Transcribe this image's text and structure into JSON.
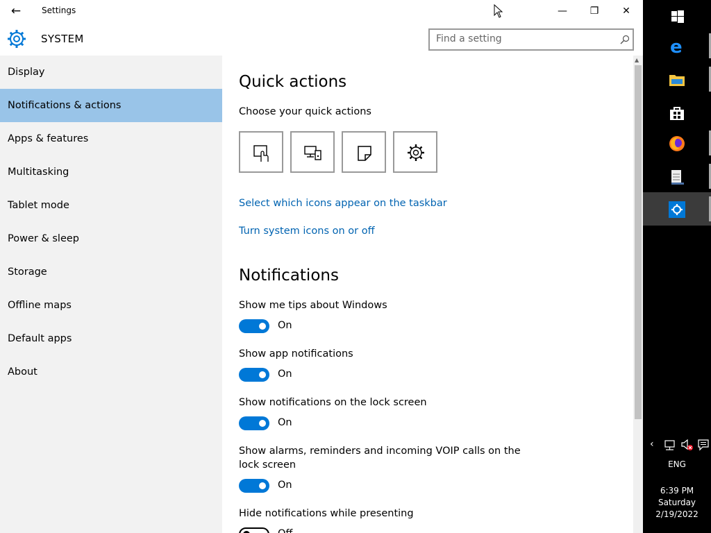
{
  "window": {
    "title": "Settings",
    "back_icon": "←",
    "minimize_icon": "—",
    "maximize_icon": "❐",
    "close_icon": "✕"
  },
  "header": {
    "section": "SYSTEM",
    "search_placeholder": "Find a setting"
  },
  "sidebar": {
    "items": [
      {
        "label": "Display"
      },
      {
        "label": "Notifications & actions",
        "selected": true
      },
      {
        "label": "Apps & features"
      },
      {
        "label": "Multitasking"
      },
      {
        "label": "Tablet mode"
      },
      {
        "label": "Power & sleep"
      },
      {
        "label": "Storage"
      },
      {
        "label": "Offline maps"
      },
      {
        "label": "Default apps"
      },
      {
        "label": "About"
      }
    ]
  },
  "quick_actions": {
    "heading": "Quick actions",
    "subheading": "Choose your quick actions",
    "tiles": [
      {
        "icon": "tablet-mode-icon"
      },
      {
        "icon": "connect-icon"
      },
      {
        "icon": "note-icon"
      },
      {
        "icon": "all-settings-icon"
      }
    ],
    "links": [
      "Select which icons appear on the taskbar",
      "Turn system icons on or off"
    ]
  },
  "notifications": {
    "heading": "Notifications",
    "settings": [
      {
        "label": "Show me tips about Windows",
        "state": "On"
      },
      {
        "label": "Show app notifications",
        "state": "On"
      },
      {
        "label": "Show notifications on the lock screen",
        "state": "On"
      },
      {
        "label": "Show alarms, reminders and incoming VOIP calls on the lock screen",
        "state": "On"
      },
      {
        "label": "Hide notifications while presenting",
        "state": "Off"
      }
    ]
  },
  "colors": {
    "accent": "#0078d7",
    "selected_nav": "#99c4e8",
    "link": "#0063b1"
  },
  "taskbar": {
    "icons": [
      "windows-start-icon",
      "edge-icon",
      "file-explorer-icon",
      "store-icon",
      "firefox-icon",
      "notepad-icon",
      "settings-icon"
    ],
    "tray": {
      "language": "ENG",
      "time": "6:39 PM",
      "day": "Saturday",
      "date": "2/19/2022"
    }
  }
}
